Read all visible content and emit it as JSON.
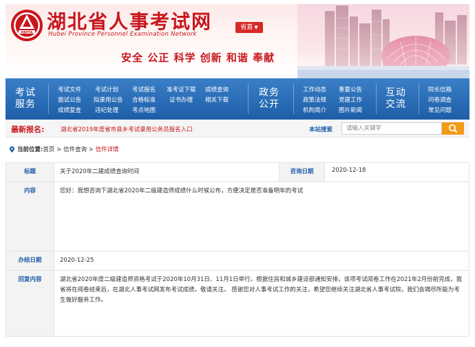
{
  "site": {
    "title": "湖北省人事考试网",
    "subtitle": "Hubei Province Personnel Examination Network",
    "logo_text": "HBPTA",
    "region_label": "省直",
    "slogan": "安全 公正 科学 创新 和谐 奉献"
  },
  "nav": {
    "groups": [
      {
        "title_line1": "考试",
        "title_line2": "服务",
        "links": [
          "考试文件",
          "考试计划",
          "考试报名",
          "准考证下载",
          "成绩查询",
          "面试公告",
          "拟录用公告",
          "合格标准",
          "证书办理",
          "相关下载",
          "成绩复查",
          "违纪处理",
          "考点地图"
        ]
      },
      {
        "title_line1": "政务",
        "title_line2": "公开",
        "links": [
          "工作动态",
          "重要公告",
          "政策法规",
          "党建工作",
          "机构简介",
          "图片新闻"
        ]
      },
      {
        "title_line1": "互动",
        "title_line2": "交流",
        "links": [
          "院长信箱",
          "问卷调查",
          "常见问题"
        ]
      }
    ]
  },
  "notice": {
    "label": "最新报名:",
    "text": "湖北省2019年度省市县乡考试录用公务员报名入口"
  },
  "search": {
    "label": "本站搜索",
    "placeholder": "请输入关键字"
  },
  "breadcrumb": {
    "prefix": "当前位置:",
    "home": "首页",
    "sep1": " > ",
    "section": "信件查询",
    "sep2": " > ",
    "current": "信件详情"
  },
  "letter": {
    "title_label": "标题",
    "title_value": "关于2020年二建成绩查询时间",
    "date_label": "咨询日期",
    "date_value": "2020-12-18",
    "content_label": "内容",
    "content_value": "您好：我想咨询下湖北省2020年二级建造师成绩什么时候公布，方便决定是否准备明年的考试",
    "done_label": "办结日期",
    "done_value": "2020-12-25",
    "reply_label": "回复内容",
    "reply_value": "湖北省2020年度二级建造师资格考试于2020年10月31日、11月1日举行。根据住房和城乡建设部通知安排，该项考试阅卷工作在2021年2月份前完成，我省将在阅卷结束后，在湖北人事考试网发布考试成绩，敬请关注。 感谢您对人事考试工作的关注，希望您继续关注湖北省人事考试院，我们会竭尽所能为考生做好服务工作。"
  },
  "colors": {
    "brand_red": "#c8161d",
    "nav_blue": "#1d5ea8",
    "search_orange": "#f39a17"
  }
}
